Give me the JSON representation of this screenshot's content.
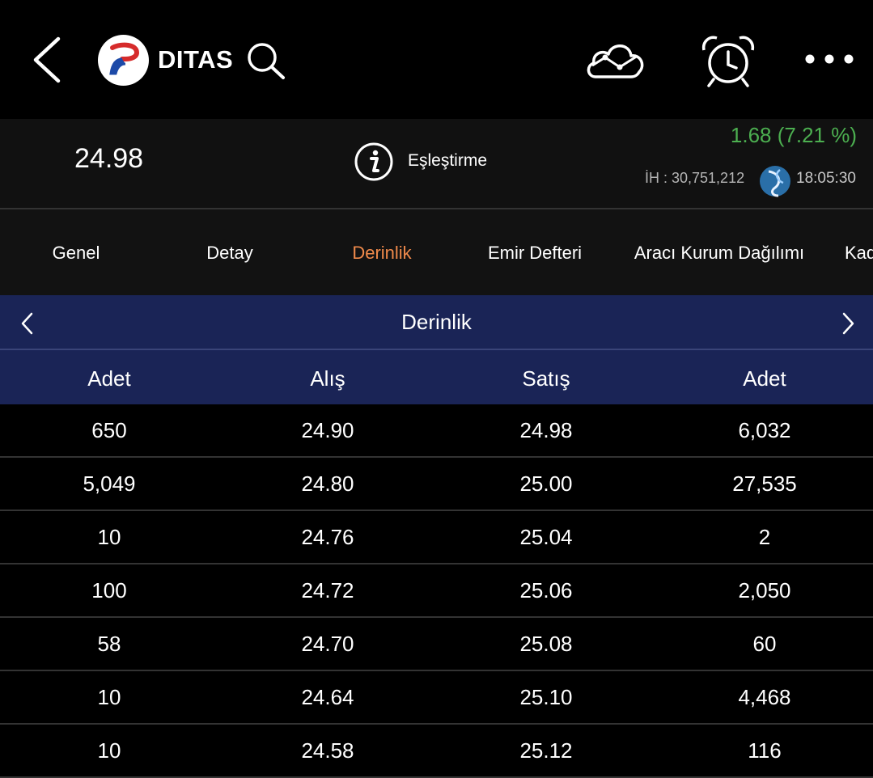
{
  "header": {
    "symbol": "DITAS",
    "icons": [
      "back-icon",
      "company-logo",
      "search-icon",
      "cloud-chart-icon",
      "alarm-clock-icon",
      "more-icon"
    ]
  },
  "quote": {
    "price": "24.98",
    "match_label": "Eşleştirme",
    "change": "1.68 (7.21 %)",
    "volume": "İH : 30,751,212",
    "time": "18:05:30",
    "change_color": "#4caf50"
  },
  "tabs": [
    {
      "label": "Genel"
    },
    {
      "label": "Detay"
    },
    {
      "label": "Derinlik"
    },
    {
      "label": "Emir Defteri"
    },
    {
      "label": "Aracı Kurum Dağılımı"
    },
    {
      "label": "Kad"
    }
  ],
  "active_tab": "Derinlik",
  "section": {
    "title": "Derinlik"
  },
  "table": {
    "columns": [
      "Adet",
      "Alış",
      "Satış",
      "Adet"
    ],
    "rows": [
      [
        "650",
        "24.90",
        "24.98",
        "6,032"
      ],
      [
        "5,049",
        "24.80",
        "25.00",
        "27,535"
      ],
      [
        "10",
        "24.76",
        "25.04",
        "2"
      ],
      [
        "100",
        "24.72",
        "25.06",
        "2,050"
      ],
      [
        "58",
        "24.70",
        "25.08",
        "60"
      ],
      [
        "10",
        "24.64",
        "25.10",
        "4,468"
      ],
      [
        "10",
        "24.58",
        "25.12",
        "116"
      ]
    ]
  },
  "colors": {
    "accent_tab": "#f08a4b",
    "header_bg": "#1a2456"
  }
}
